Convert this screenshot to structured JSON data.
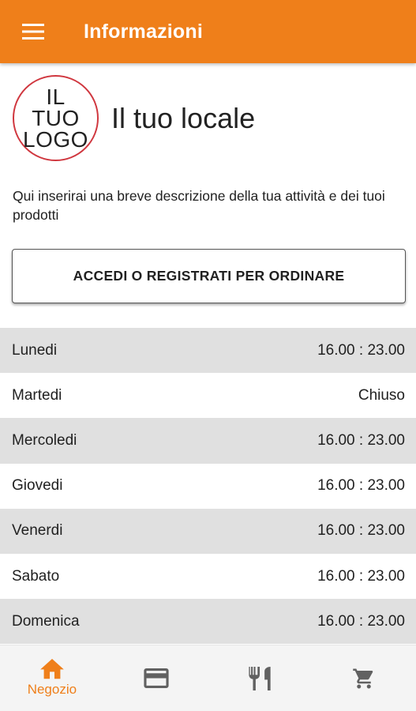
{
  "appbar": {
    "title": "Informazioni",
    "menu_icon": "menu-icon"
  },
  "venue": {
    "logo_lines": [
      "IL",
      "TUO",
      "LOGO"
    ],
    "name": "Il tuo locale",
    "description": "Qui inserirai una breve descrizione della tua attività e dei tuoi prodotti"
  },
  "login_button": "ACCEDI O REGISTRATI PER ORDINARE",
  "hours": [
    {
      "day": "Lunedi",
      "time": "16.00 : 23.00"
    },
    {
      "day": "Martedi",
      "time": "Chiuso"
    },
    {
      "day": "Mercoledi",
      "time": "16.00 : 23.00"
    },
    {
      "day": "Giovedi",
      "time": "16.00 : 23.00"
    },
    {
      "day": "Venerdi",
      "time": "16.00 : 23.00"
    },
    {
      "day": "Sabato",
      "time": "16.00 : 23.00"
    },
    {
      "day": "Domenica",
      "time": "16.00 : 23.00"
    }
  ],
  "bottom_nav": [
    {
      "icon": "home-icon",
      "label": "Negozio",
      "active": true
    },
    {
      "icon": "credit-card-icon",
      "label": ""
    },
    {
      "icon": "restaurant-icon",
      "label": ""
    },
    {
      "icon": "cart-icon",
      "label": ""
    }
  ],
  "colors": {
    "accent": "#ef7f1a",
    "icon_gray": "#616161",
    "logo_ring": "#d0373f",
    "row_shade": "#e0e0e0"
  }
}
